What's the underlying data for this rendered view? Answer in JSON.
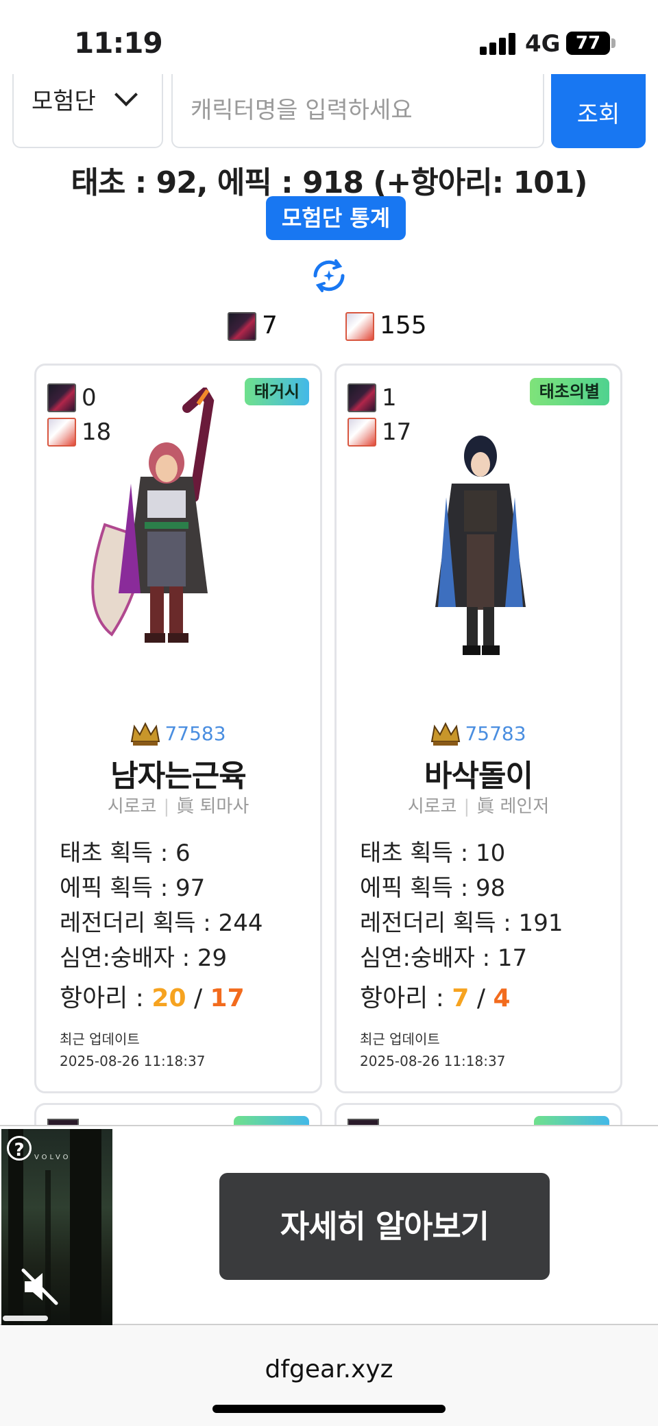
{
  "status_bar": {
    "time": "11:19",
    "network": "4G",
    "battery": "77"
  },
  "search": {
    "category": "모험단",
    "placeholder": "캐릭터명을 입력하세요",
    "button": "조회"
  },
  "summary": "태초 : 92, 에픽 : 918 (+항아리: 101)",
  "stats_button": "모험단 통계",
  "totals": {
    "dark_count": "7",
    "light_count": "155"
  },
  "cards": [
    {
      "dark_count": "0",
      "light_count": "18",
      "badge": "태거시",
      "level": "77583",
      "name": "남자는근육",
      "server": "시로코",
      "job": "眞 퇴마사",
      "stat_taecho": "태초 획득 : 6",
      "stat_epic": "에픽 획득 : 97",
      "stat_legendary": "레전더리 획득 : 244",
      "stat_simyeon": "심연:숭배자 : 29",
      "hang_label": "항아리 : ",
      "hang_a": "20",
      "hang_slash": " / ",
      "hang_b": "17",
      "updated_label": "최근 업데이트",
      "updated_time": "2025-08-26 11:18:37"
    },
    {
      "dark_count": "1",
      "light_count": "17",
      "badge": "태초의별",
      "level": "75783",
      "name": "바삭돌이",
      "server": "시로코",
      "job": "眞 레인저",
      "stat_taecho": "태초 획득 : 10",
      "stat_epic": "에픽 획득 : 98",
      "stat_legendary": "레전더리 획득 : 191",
      "stat_simyeon": "심연:숭배자 : 17",
      "hang_label": "항아리 : ",
      "hang_a": "7",
      "hang_slash": " / ",
      "hang_b": "4",
      "updated_label": "최근 업데이트",
      "updated_time": "2025-08-26 11:18:37"
    }
  ],
  "ad": {
    "brand": "VOLVO",
    "cta": "자세히 알아보기"
  },
  "url": "dfgear.xyz",
  "colors": {
    "accent": "#1877f2",
    "hang_a": "#f6a320",
    "hang_b": "#f26b1d",
    "level": "#4a8ee0"
  }
}
